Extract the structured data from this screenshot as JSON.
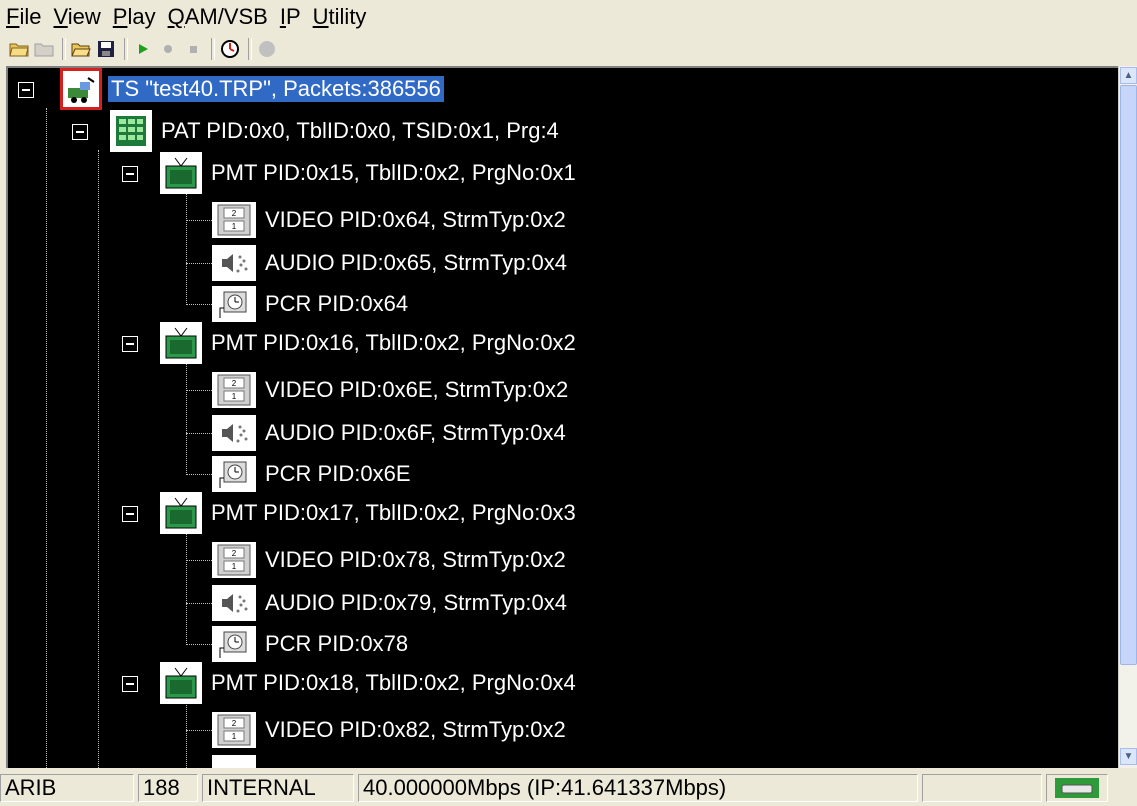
{
  "menu": {
    "items": [
      "File",
      "View",
      "Play",
      "QAM/VSB",
      "IP",
      "Utility"
    ]
  },
  "toolbar": {
    "icons": [
      "new-folder-icon",
      "folder-disabled-icon",
      "open-folder-icon",
      "save-icon",
      "play-icon",
      "record-icon",
      "stop-icon",
      "timer-icon",
      "circle-icon"
    ]
  },
  "tree": {
    "root": "TS \"test40.TRP\", Packets:386556",
    "pat": "PAT PID:0x0, TblID:0x0, TSID:0x1, Prg:4",
    "programs": [
      {
        "pmt": "PMT PID:0x15, TblID:0x2, PrgNo:0x1",
        "video": "VIDEO PID:0x64, StrmTyp:0x2",
        "audio": "AUDIO PID:0x65, StrmTyp:0x4",
        "pcr": "PCR PID:0x64"
      },
      {
        "pmt": "PMT PID:0x16, TblID:0x2, PrgNo:0x2",
        "video": "VIDEO PID:0x6E, StrmTyp:0x2",
        "audio": "AUDIO PID:0x6F, StrmTyp:0x4",
        "pcr": "PCR PID:0x6E"
      },
      {
        "pmt": "PMT PID:0x17, TblID:0x2, PrgNo:0x3",
        "video": "VIDEO PID:0x78, StrmTyp:0x2",
        "audio": "AUDIO PID:0x79, StrmTyp:0x4",
        "pcr": "PCR PID:0x78"
      },
      {
        "pmt": "PMT PID:0x18, TblID:0x2, PrgNo:0x4",
        "video": "VIDEO PID:0x82, StrmTyp:0x2"
      }
    ]
  },
  "status": {
    "standard": "ARIB",
    "packet_size": "188",
    "clock": "INTERNAL",
    "bitrate": "40.000000Mbps (IP:41.641337Mbps)"
  },
  "colors": {
    "selection": "#316ac5",
    "tree_bg": "#000000",
    "root_icon_border": "#d62020"
  }
}
